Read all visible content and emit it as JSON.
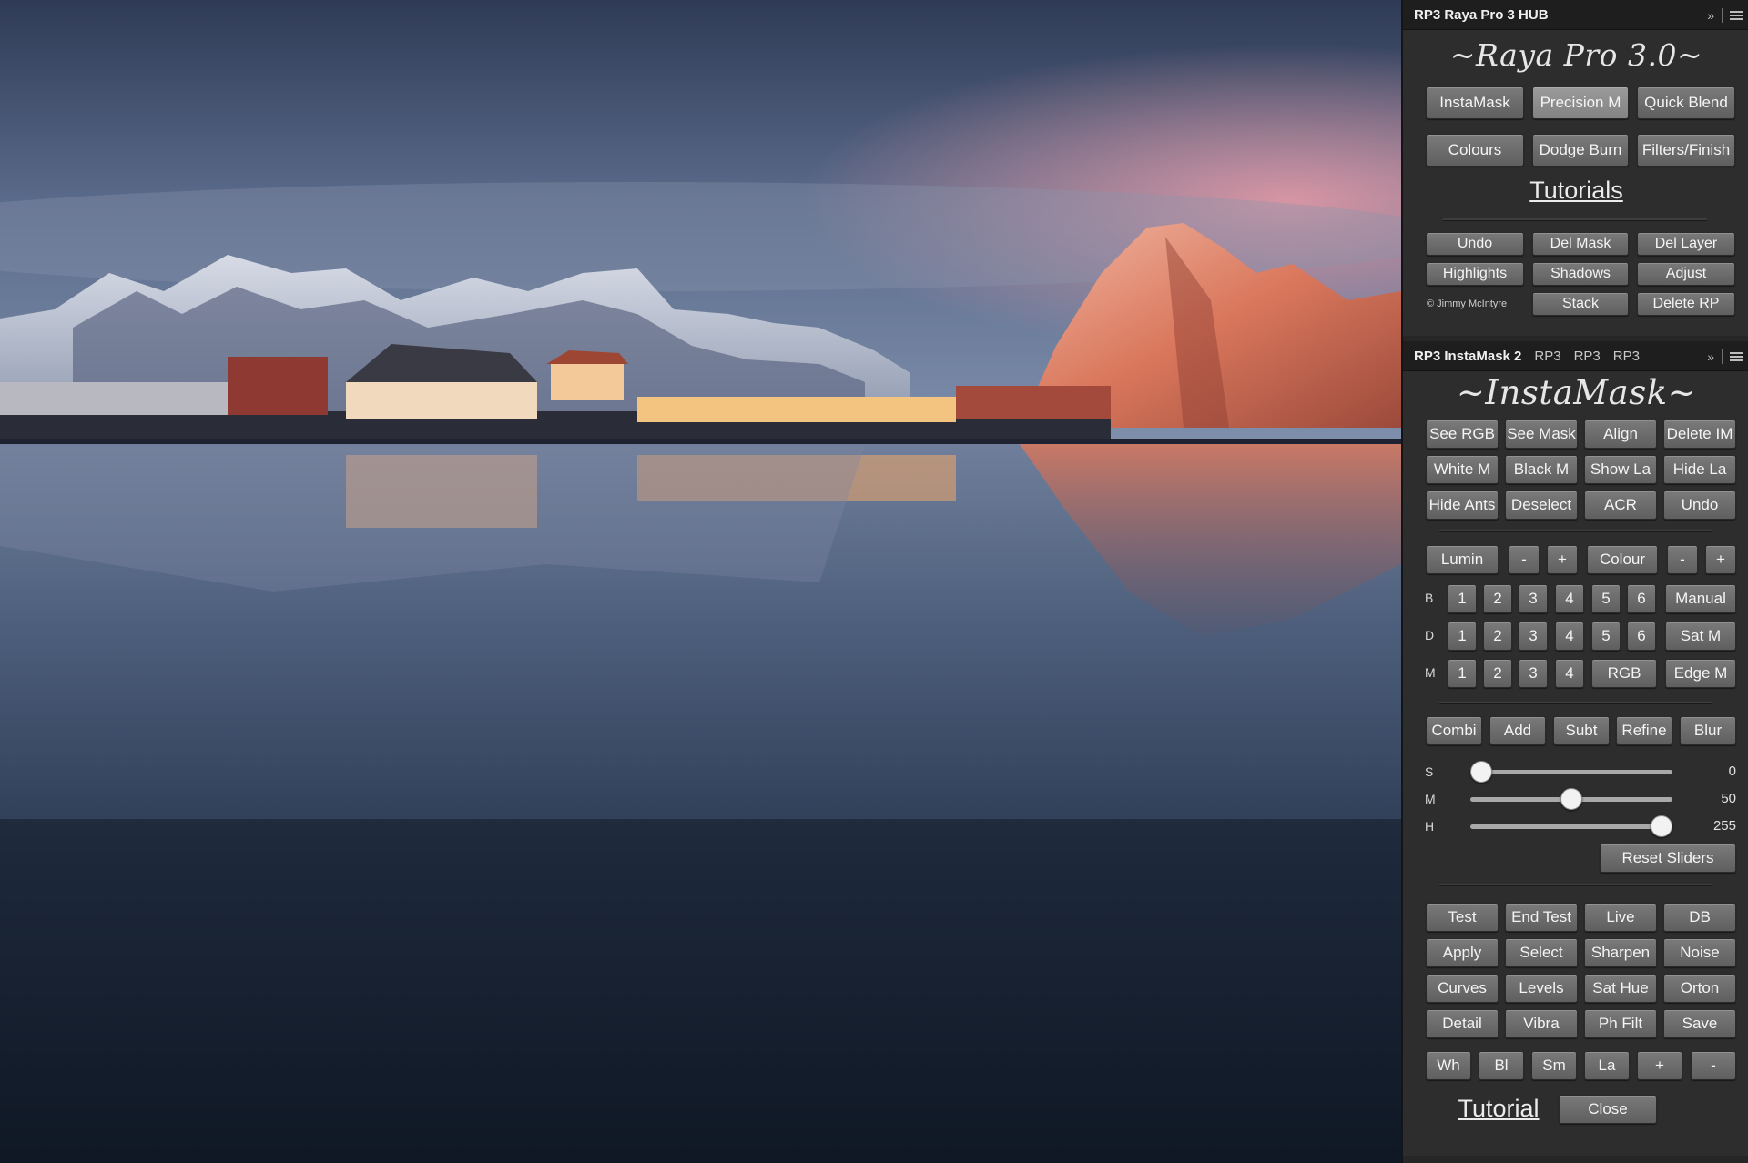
{
  "hub": {
    "tab": "RP3 Raya Pro 3 HUB",
    "title": "~Raya Pro 3.0~",
    "row1": [
      "InstaMask",
      "Precision M",
      "Quick Blend"
    ],
    "row2": [
      "Colours",
      "Dodge Burn",
      "Filters/Finish"
    ],
    "tutorials": "Tutorials",
    "row3": [
      "Undo",
      "Del Mask",
      "Del Layer"
    ],
    "row4": [
      "Highlights",
      "Shadows",
      "Adjust"
    ],
    "credit": "© Jimmy McIntyre",
    "row5": [
      "Stack",
      "Delete RP"
    ]
  },
  "instamask": {
    "tabs": [
      "RP3 InstaMask 2",
      "RP3",
      "RP3",
      "RP3"
    ],
    "title": "~InstaMask~",
    "grid1": [
      [
        "See RGB",
        "See Mask",
        "Align",
        "Delete IM"
      ],
      [
        "White M",
        "Black M",
        "Show La",
        "Hide La"
      ],
      [
        "Hide Ants",
        "Deselect",
        "ACR",
        "Undo"
      ]
    ],
    "lumin": {
      "label": "Lumin",
      "minus": "-",
      "plus": "+"
    },
    "colour": {
      "label": "Colour",
      "minus": "-",
      "plus": "+"
    },
    "b_row": {
      "label": "B",
      "nums": [
        "1",
        "2",
        "3",
        "4",
        "5",
        "6"
      ],
      "extra": "Manual"
    },
    "d_row": {
      "label": "D",
      "nums": [
        "1",
        "2",
        "3",
        "4",
        "5",
        "6"
      ],
      "extra": "Sat M"
    },
    "m_row": {
      "label": "M",
      "nums": [
        "1",
        "2",
        "3",
        "4"
      ],
      "rgb": "RGB",
      "extra": "Edge M"
    },
    "ops": [
      "Combi",
      "Add",
      "Subt",
      "Refine",
      "Blur"
    ],
    "sliders": [
      {
        "label": "S",
        "value": "0",
        "pos": 0.0
      },
      {
        "label": "M",
        "value": "50",
        "pos": 0.5
      },
      {
        "label": "H",
        "value": "255",
        "pos": 1.0
      }
    ],
    "reset": "Reset Sliders",
    "grid2": [
      [
        "Test",
        "End Test",
        "Live",
        "DB"
      ],
      [
        "Apply",
        "Select",
        "Sharpen",
        "Noise"
      ],
      [
        "Curves",
        "Levels",
        "Sat Hue",
        "Orton"
      ],
      [
        "Detail",
        "Vibra",
        "Ph Filt",
        "Save"
      ]
    ],
    "bottom": [
      "Wh",
      "Bl",
      "Sm",
      "La",
      "+",
      "-"
    ],
    "tutorial": "Tutorial",
    "close": "Close"
  },
  "icons": {
    "collapse": "double-chevron-icon",
    "menu": "panel-menu-icon"
  },
  "colors": {
    "panel_bg": "#2d2d2d",
    "button": "#6b6b6b",
    "button_highlight": "#8e8e8e",
    "tabbar": "#1e1e1e"
  }
}
